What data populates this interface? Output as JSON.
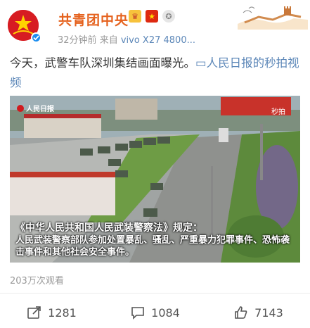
{
  "header": {
    "username": "共青团中央",
    "time": "32分钟前",
    "source_prefix": "来自",
    "device": "vivo X27 4800...",
    "badges": [
      "vip-badge-icon",
      "china-flag-icon",
      "medal-icon"
    ]
  },
  "post": {
    "text": "今天，武警车队深圳集结画面曝光。",
    "link_icon": "video-link-icon",
    "link_text": "人民日报的秒拍视频"
  },
  "video": {
    "logo_text": "人民日报",
    "watermark": "秒拍",
    "caption_title": "《中华人民共和国人民武装警察法》规定：",
    "caption_body": "人民武装警察部队参加处置暴乱、骚乱、严重暴力犯罪事件、恐怖袭击事件和其他社会安全事件。"
  },
  "stats": {
    "views": "203万次观看"
  },
  "actions": {
    "repost": "1281",
    "comment": "1084",
    "like": "7143"
  },
  "colors": {
    "username": "#e5621e",
    "link": "#5c87b8",
    "meta": "#999999"
  }
}
